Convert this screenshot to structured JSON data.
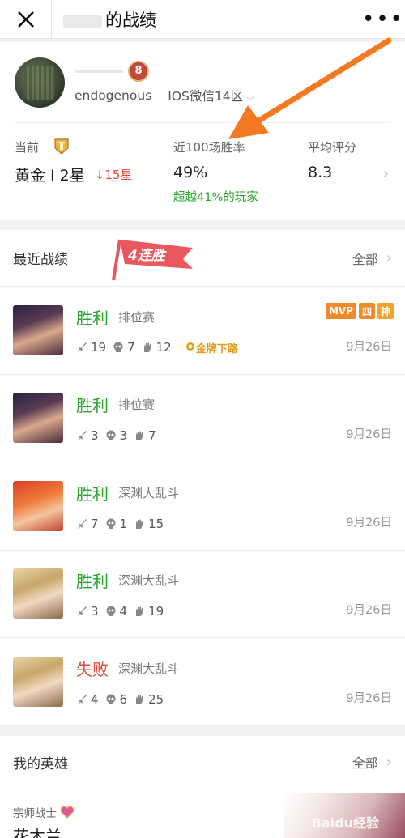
{
  "topbar": {
    "title": "的战绩",
    "close_icon": "close-icon",
    "more_label": "•••"
  },
  "profile": {
    "level": "8",
    "nickname": "endogenous",
    "server": "IOS微信14区",
    "stats": {
      "current_label": "当前",
      "rank": "黄金 I 2星",
      "rank_change": "↓15星",
      "winrate_label": "近100场胜率",
      "winrate": "49%",
      "beat": "超越41%的玩家",
      "score_label": "平均评分",
      "score": "8.3"
    }
  },
  "recent": {
    "title": "最近战绩",
    "streak": "4连胜",
    "all_label": "全部",
    "matches": [
      {
        "result": "胜利",
        "outcome": "win",
        "mode": "排位赛",
        "k": "19",
        "d": "7",
        "a": "12",
        "gold": "金牌下路",
        "date": "9月26日",
        "badges": [
          "MVP",
          "四",
          "神"
        ]
      },
      {
        "result": "胜利",
        "outcome": "win",
        "mode": "排位赛",
        "k": "3",
        "d": "3",
        "a": "7",
        "date": "9月26日"
      },
      {
        "result": "胜利",
        "outcome": "win",
        "mode": "深渊大乱斗",
        "k": "7",
        "d": "1",
        "a": "15",
        "date": "9月26日"
      },
      {
        "result": "胜利",
        "outcome": "win",
        "mode": "深渊大乱斗",
        "k": "3",
        "d": "4",
        "a": "19",
        "date": "9月26日"
      },
      {
        "result": "失败",
        "outcome": "lose",
        "mode": "深渊大乱斗",
        "k": "4",
        "d": "6",
        "a": "25",
        "date": "9月26日"
      }
    ]
  },
  "heroes": {
    "title": "我的英雄",
    "all_label": "全部",
    "first": {
      "role": "宗师战士",
      "name": "花木兰"
    },
    "watermark": "Baidu经验"
  },
  "colors": {
    "win": "#27a52b",
    "lose": "#e14b3b",
    "drop": "#e64a3b",
    "accent": "#f08a2c",
    "annotation_arrow": "#f47a22"
  }
}
